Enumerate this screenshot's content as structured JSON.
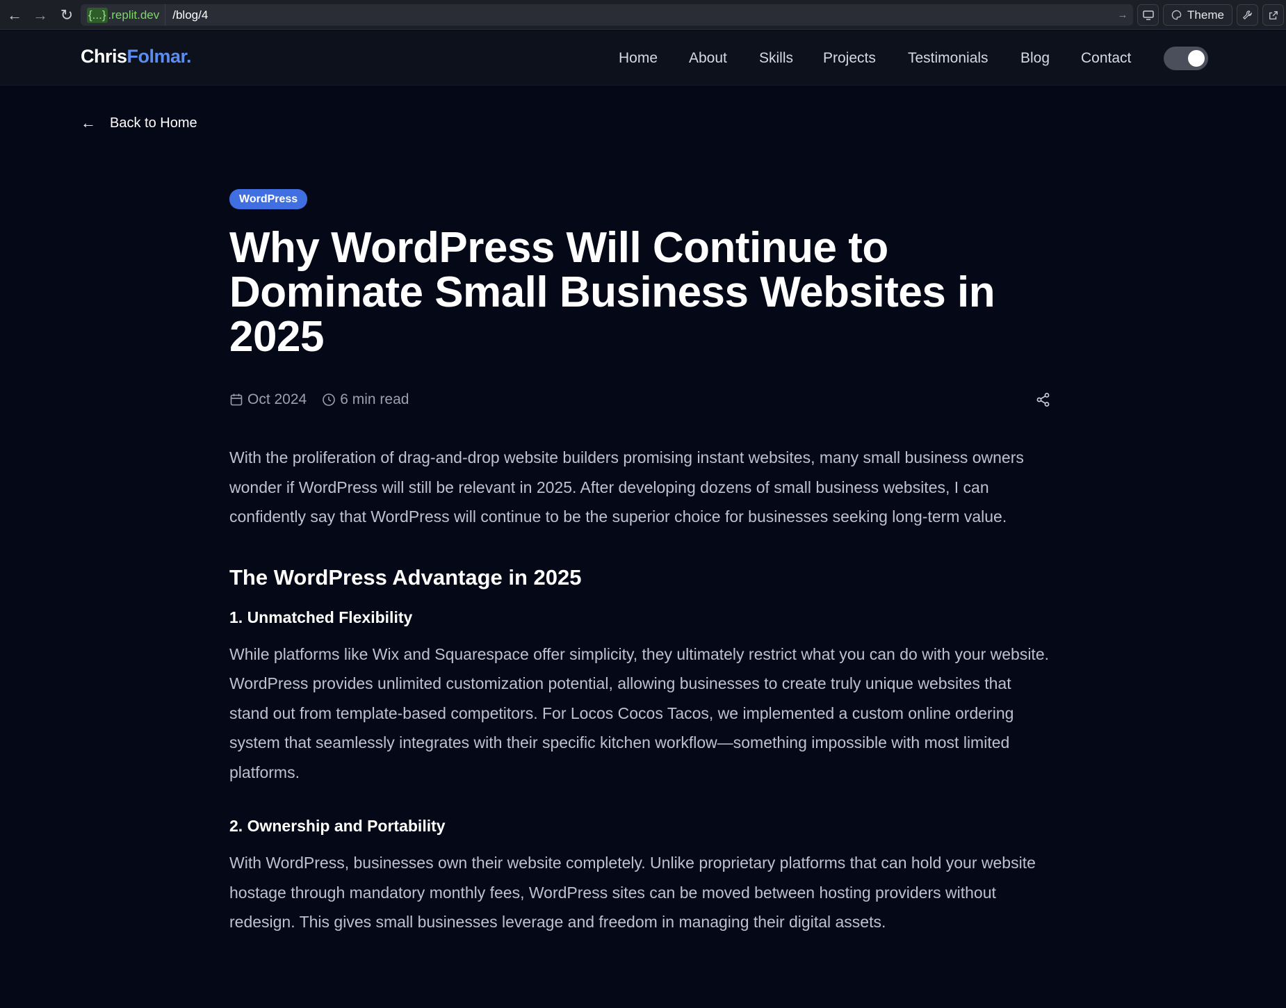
{
  "browser": {
    "host_brace": "{...}",
    "host_rest": ".replit.dev",
    "path": "/blog/4",
    "theme_label": "Theme",
    "back_icon": "←",
    "forward_icon": "→",
    "reload_icon": "↻",
    "go_icon": "→"
  },
  "header": {
    "logo_first": "Chris",
    "logo_second": "Folmar.",
    "nav": [
      {
        "label": "Home"
      },
      {
        "label": "About"
      },
      {
        "label": "Skills"
      },
      {
        "label": "Projects"
      },
      {
        "label": "Testimonials"
      },
      {
        "label": "Blog"
      },
      {
        "label": "Contact"
      }
    ],
    "theme_toggle_on": true
  },
  "back_link": {
    "label": "Back to Home",
    "icon": "←"
  },
  "article": {
    "tag": "WordPress",
    "title": "Why WordPress Will Continue to Dominate Small Business Websites in 2025",
    "date": "Oct 2024",
    "read_time": "6 min read",
    "lead": "With the proliferation of drag-and-drop website builders promising instant websites, many small business owners wonder if WordPress will still be relevant in 2025. After developing dozens of small business websites, I can confidently say that WordPress will continue to be the superior choice for businesses seeking long-term value.",
    "section_heading": "The WordPress Advantage in 2025",
    "sub1_heading": "1. Unmatched Flexibility",
    "sub1_body": "While platforms like Wix and Squarespace offer simplicity, they ultimately restrict what you can do with your website. WordPress provides unlimited customization potential, allowing businesses to create truly unique websites that stand out from template-based competitors. For Locos Cocos Tacos, we implemented a custom online ordering system that seamlessly integrates with their specific kitchen workflow—something impossible with most limited platforms.",
    "sub2_heading": "2. Ownership and Portability",
    "sub2_body": "With WordPress, businesses own their website completely. Unlike proprietary platforms that can hold your website hostage through mandatory monthly fees, WordPress sites can be moved between hosting providers without redesign. This gives small businesses leverage and freedom in managing their digital assets."
  },
  "colors": {
    "page_bg": "#050816",
    "header_bg": "#0c111c",
    "accent": "#5b8cf0",
    "tag_bg": "#3f6fe0"
  }
}
